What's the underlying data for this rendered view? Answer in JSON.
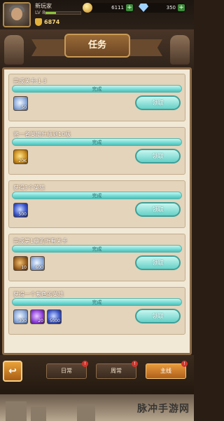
{
  "player": {
    "name": "新玩家",
    "level_label": "LV",
    "level": "8",
    "power": "6874"
  },
  "resources": {
    "gold": "6111",
    "gems": "350",
    "add_label": "+"
  },
  "header": {
    "title": "任务"
  },
  "quests": [
    {
      "title": "完成关卡:1-3",
      "status": "完成",
      "claim": "领取",
      "rewards": [
        {
          "icon": "gem-icon",
          "count": "50"
        }
      ]
    },
    {
      "title": "将一名英雄升级到10级",
      "status": "完成",
      "claim": "领取",
      "rewards": [
        {
          "icon": "gold-icon",
          "count": "20K"
        }
      ]
    },
    {
      "title": "获得3个英雄",
      "status": "完成",
      "claim": "领取",
      "rewards": [
        {
          "icon": "hero-orb-icon",
          "count": "500"
        }
      ]
    },
    {
      "title": "完成第1章的所有关卡",
      "status": "完成",
      "claim": "领取",
      "rewards": [
        {
          "icon": "chest-icon",
          "count": "10"
        },
        {
          "icon": "gem-icon",
          "count": "600"
        }
      ]
    },
    {
      "title": "获得一个紫色的英雄",
      "status": "完成",
      "claim": "领取",
      "rewards": [
        {
          "icon": "gem-icon",
          "count": "300"
        },
        {
          "icon": "purple-orb-icon",
          "count": "20"
        },
        {
          "icon": "hero-orb-icon",
          "count": "5000"
        }
      ]
    }
  ],
  "nav": {
    "back_symbol": "↩",
    "tabs": [
      {
        "label": "日常",
        "badge": "!"
      },
      {
        "label": "周常",
        "badge": "!"
      },
      {
        "label": "主线",
        "badge": "!"
      }
    ]
  },
  "watermark": "脉冲手游网"
}
